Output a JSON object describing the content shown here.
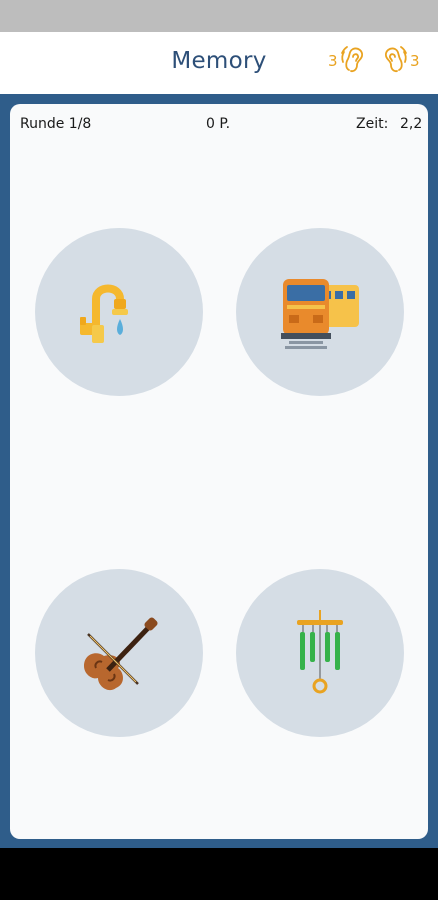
{
  "header": {
    "title": "Memory",
    "hearing_left": {
      "count": "3",
      "icon": "hearing-ear-icon"
    },
    "hearing_right": {
      "count": "3",
      "icon": "hearing-ear-icon"
    }
  },
  "info": {
    "round": "Runde 1/8",
    "points": "0 P.",
    "time_label": "Zeit:",
    "time_value": "2,2"
  },
  "cards": [
    {
      "icon": "faucet-icon"
    },
    {
      "icon": "train-icon"
    },
    {
      "icon": "violin-icon"
    },
    {
      "icon": "wind-chime-icon"
    }
  ],
  "colors": {
    "header_text": "#2d4f78",
    "accent": "#e9a321",
    "frame": "#2f5d8a",
    "card_bg": "#d5dde5",
    "status_bar": "#bdbdbd"
  }
}
